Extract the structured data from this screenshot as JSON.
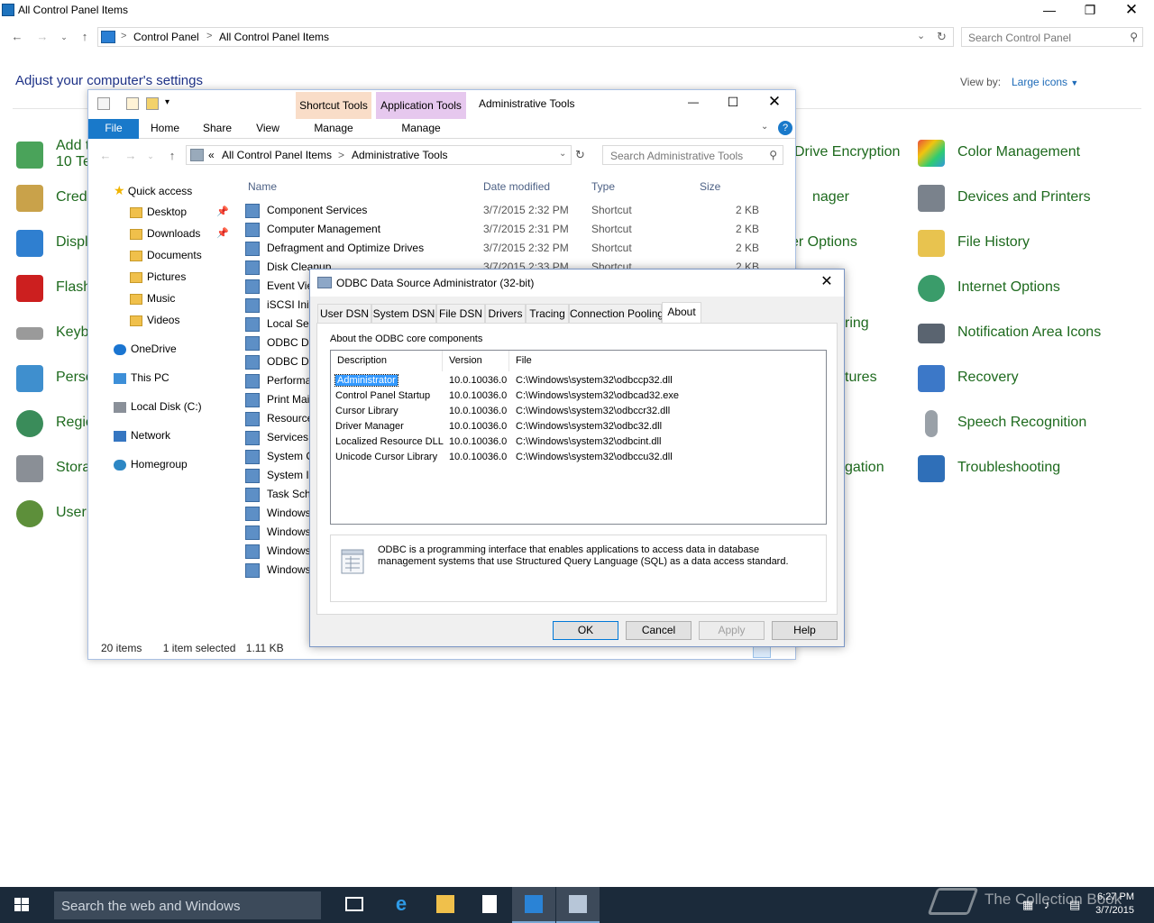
{
  "control_panel": {
    "window_title": "All Control Panel Items",
    "breadcrumb": [
      "Control Panel",
      "All Control Panel Items"
    ],
    "search_placeholder": "Search Control Panel",
    "heading": "Adjust your computer's settings",
    "view_by_label": "View by:",
    "view_by_value": "Large icons",
    "left_items": [
      "Add t",
      "10 Te",
      "Crede",
      "Displ",
      "Flash",
      "Keyb",
      "Perso",
      "Regio",
      "Stora",
      "User"
    ],
    "mid_items": [
      "Drive Encryption",
      "nager",
      "er Options",
      "ring",
      "tures",
      "gation"
    ],
    "right_items": [
      "Color Management",
      "Devices and Printers",
      "File History",
      "Internet Options",
      "Notification Area Icons",
      "Recovery",
      "Speech Recognition",
      "Troubleshooting"
    ]
  },
  "explorer": {
    "title": "Administrative Tools",
    "context_tabs": [
      "Shortcut Tools",
      "Application Tools"
    ],
    "context_colors": [
      "#f9ddc8",
      "#e6c8ee"
    ],
    "ribbon_tabs": [
      "File",
      "Home",
      "Share",
      "View",
      "Manage",
      "Manage"
    ],
    "address_prefix": "«",
    "breadcrumb": [
      "All Control Panel Items",
      "Administrative Tools"
    ],
    "search_placeholder": "Search Administrative Tools",
    "nav": [
      "Quick access",
      "Desktop",
      "Downloads",
      "Documents",
      "Pictures",
      "Music",
      "Videos",
      "OneDrive",
      "This PC",
      "Local Disk (C:)",
      "Network",
      "Homegroup"
    ],
    "columns": [
      "Name",
      "Date modified",
      "Type",
      "Size"
    ],
    "files": [
      {
        "name": "Component Services",
        "date": "3/7/2015 2:32 PM",
        "type": "Shortcut",
        "size": "2 KB"
      },
      {
        "name": "Computer Management",
        "date": "3/7/2015 2:31 PM",
        "type": "Shortcut",
        "size": "2 KB"
      },
      {
        "name": "Defragment and Optimize Drives",
        "date": "3/7/2015 2:32 PM",
        "type": "Shortcut",
        "size": "2 KB"
      },
      {
        "name": "Disk Cleanup",
        "date": "3/7/2015 2:33 PM",
        "type": "Shortcut",
        "size": "2 KB"
      },
      {
        "name": "Event Vie",
        "date": "",
        "type": "",
        "size": ""
      },
      {
        "name": "iSCSI Init",
        "date": "",
        "type": "",
        "size": ""
      },
      {
        "name": "Local Sec",
        "date": "",
        "type": "",
        "size": ""
      },
      {
        "name": "ODBC Da",
        "date": "",
        "type": "",
        "size": ""
      },
      {
        "name": "ODBC Da",
        "date": "",
        "type": "",
        "size": ""
      },
      {
        "name": "Performa",
        "date": "",
        "type": "",
        "size": ""
      },
      {
        "name": "Print Mai",
        "date": "",
        "type": "",
        "size": ""
      },
      {
        "name": "Resource",
        "date": "",
        "type": "",
        "size": ""
      },
      {
        "name": "Services",
        "date": "",
        "type": "",
        "size": ""
      },
      {
        "name": "System C",
        "date": "",
        "type": "",
        "size": ""
      },
      {
        "name": "System In",
        "date": "",
        "type": "",
        "size": ""
      },
      {
        "name": "Task Sche",
        "date": "",
        "type": "",
        "size": ""
      },
      {
        "name": "Windows",
        "date": "",
        "type": "",
        "size": ""
      },
      {
        "name": "Windows",
        "date": "",
        "type": "",
        "size": ""
      },
      {
        "name": "Windows",
        "date": "",
        "type": "",
        "size": ""
      },
      {
        "name": "Windows",
        "date": "",
        "type": "",
        "size": ""
      }
    ],
    "status_count": "20 items",
    "status_selected": "1 item selected",
    "status_size": "1.11 KB"
  },
  "odbc": {
    "title": "ODBC Data Source Administrator (32-bit)",
    "tabs": [
      "User DSN",
      "System DSN",
      "File DSN",
      "Drivers",
      "Tracing",
      "Connection Pooling",
      "About"
    ],
    "active_tab": "About",
    "caption": "About the ODBC core components",
    "columns": [
      "Description",
      "Version",
      "File"
    ],
    "components": [
      {
        "desc": "Administrator",
        "version": "10.0.10036.0",
        "file": "C:\\Windows\\system32\\odbccp32.dll"
      },
      {
        "desc": "Control Panel Startup",
        "version": "10.0.10036.0",
        "file": "C:\\Windows\\system32\\odbcad32.exe"
      },
      {
        "desc": "Cursor Library",
        "version": "10.0.10036.0",
        "file": "C:\\Windows\\system32\\odbccr32.dll"
      },
      {
        "desc": "Driver Manager",
        "version": "10.0.10036.0",
        "file": "C:\\Windows\\system32\\odbc32.dll"
      },
      {
        "desc": "Localized Resource DLL",
        "version": "10.0.10036.0",
        "file": "C:\\Windows\\system32\\odbcint.dll"
      },
      {
        "desc": "Unicode Cursor Library",
        "version": "10.0.10036.0",
        "file": "C:\\Windows\\system32\\odbccu32.dll"
      }
    ],
    "info_text": "ODBC is a programming interface that enables applications to access data in database management systems that use Structured Query Language (SQL) as a data access standard.",
    "buttons": {
      "ok": "OK",
      "cancel": "Cancel",
      "apply": "Apply",
      "help": "Help"
    }
  },
  "taskbar": {
    "search_placeholder": "Search the web and Windows",
    "time": "6:27 PM",
    "date": "3/7/2015",
    "watermark": "The Collection Book"
  }
}
